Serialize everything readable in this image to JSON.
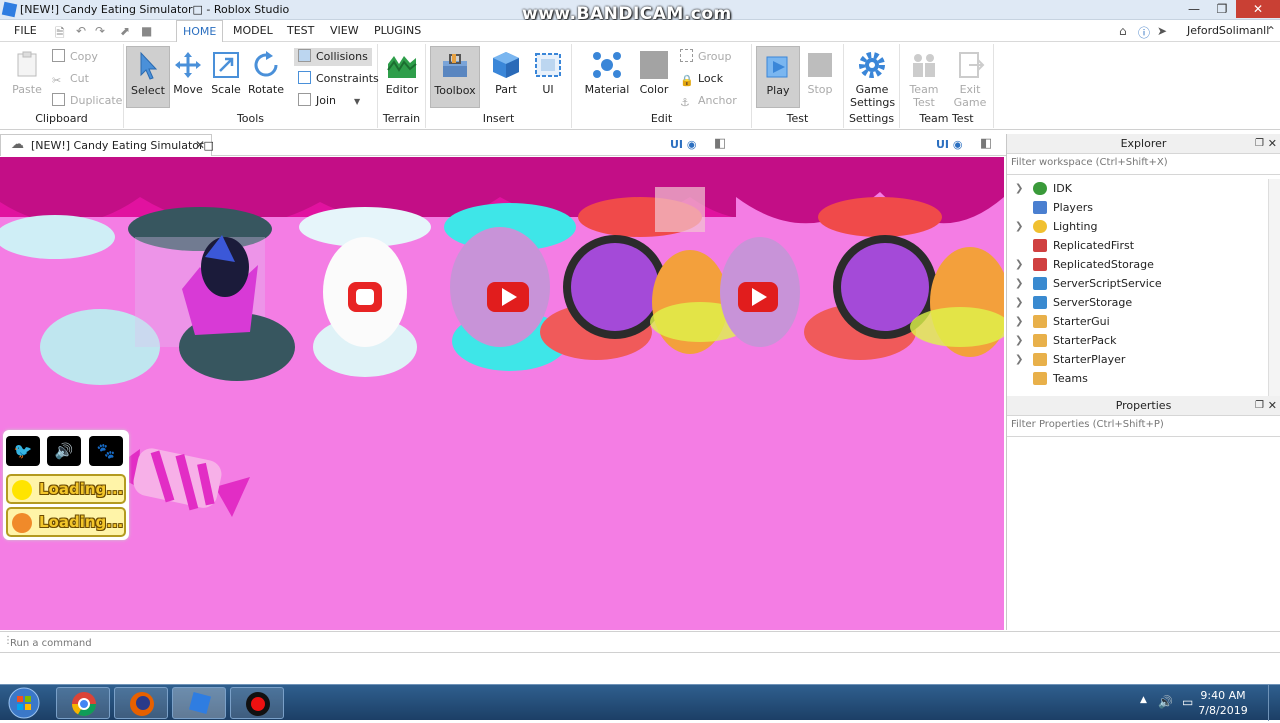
{
  "window": {
    "title": "[NEW!] Candy Eating Simulator□ - Roblox Studio",
    "watermark": "www.BANDICAM.com"
  },
  "menubar": {
    "file": "FILE",
    "tabs": [
      "HOME",
      "MODEL",
      "TEST",
      "VIEW",
      "PLUGINS"
    ],
    "user": "JefordSolimanll"
  },
  "ribbon": {
    "clipboard": {
      "label": "Clipboard",
      "paste": "Paste",
      "copy": "Copy",
      "cut": "Cut",
      "duplicate": "Duplicate"
    },
    "tools": {
      "label": "Tools",
      "select": "Select",
      "move": "Move",
      "scale": "Scale",
      "rotate": "Rotate",
      "collisions": "Collisions",
      "constraints": "Constraints",
      "join": "Join"
    },
    "terrain": {
      "label": "Terrain",
      "editor": "Editor"
    },
    "insert": {
      "label": "Insert",
      "toolbox": "Toolbox",
      "part": "Part",
      "ui": "UI"
    },
    "edit": {
      "label": "Edit",
      "material": "Material",
      "color": "Color",
      "group": "Group",
      "lock": "Lock",
      "anchor": "Anchor"
    },
    "test": {
      "label": "Test",
      "play": "Play",
      "stop": "Stop"
    },
    "settings": {
      "label": "Settings",
      "game_settings_1": "Game",
      "game_settings_2": "Settings"
    },
    "teamtest": {
      "label": "Team Test",
      "team_1": "Team",
      "team_2": "Test",
      "exit_1": "Exit",
      "exit_2": "Game"
    }
  },
  "doc_tab": {
    "label": "[NEW!] Candy Eating Simulator□",
    "ui_toggle": "UI"
  },
  "game_ui": {
    "loading_1": "Loading...",
    "loading_2": "Loading..."
  },
  "explorer": {
    "title": "Explorer",
    "filter_placeholder": "Filter workspace (Ctrl+Shift+X)",
    "items": [
      {
        "label": "IDK",
        "color": "#3a9a3a"
      },
      {
        "label": "Players",
        "color": "#4a7fd0"
      },
      {
        "label": "Lighting",
        "color": "#f0c030"
      },
      {
        "label": "ReplicatedFirst",
        "color": "#d04040"
      },
      {
        "label": "ReplicatedStorage",
        "color": "#d04040"
      },
      {
        "label": "ServerScriptService",
        "color": "#3a8ad0"
      },
      {
        "label": "ServerStorage",
        "color": "#3a8ad0"
      },
      {
        "label": "StarterGui",
        "color": "#e8b04a"
      },
      {
        "label": "StarterPack",
        "color": "#e8b04a"
      },
      {
        "label": "StarterPlayer",
        "color": "#e8b04a"
      },
      {
        "label": "Teams",
        "color": "#e8b04a"
      }
    ]
  },
  "properties": {
    "title": "Properties",
    "filter_placeholder": "Filter Properties (Ctrl+Shift+P)"
  },
  "command": {
    "placeholder": "Run a command"
  },
  "clock": {
    "time": "9:40 AM",
    "date": "7/8/2019"
  }
}
